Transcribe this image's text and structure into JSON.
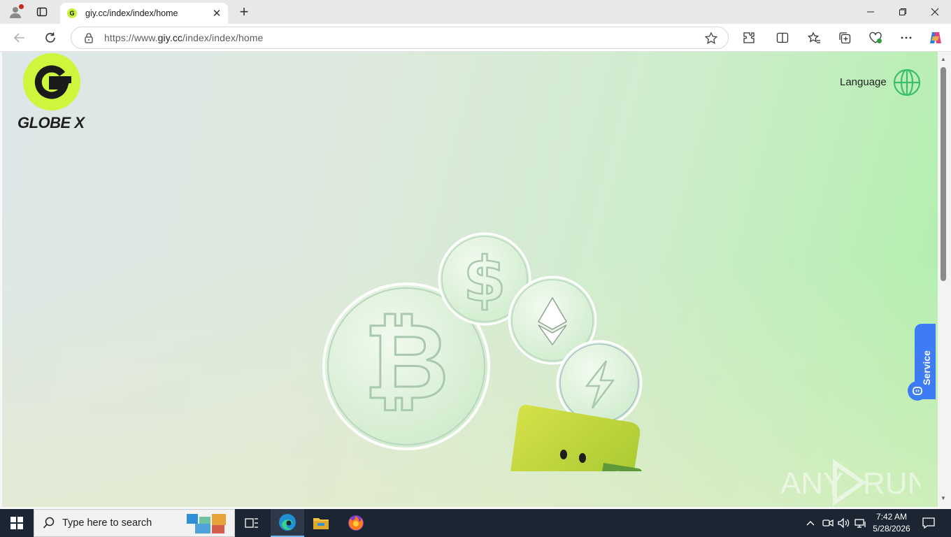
{
  "browser": {
    "tab_title": "giy.cc/index/index/home",
    "tab_favicon_letter": "G",
    "url_prefix": "https://www.",
    "url_domain": "giy.cc",
    "url_path": "/index/index/home"
  },
  "page": {
    "brand_name": "GLOBE X",
    "language_label": "Language",
    "service_label": "Service",
    "accent_color": "#cdf63d",
    "service_color": "#3d7cf5"
  },
  "watermark": {
    "text_left": "ANY",
    "text_right": "RUN"
  },
  "taskbar": {
    "search_placeholder": "Type here to search",
    "time": "7:42 AM",
    "date": "5/28/2026"
  }
}
